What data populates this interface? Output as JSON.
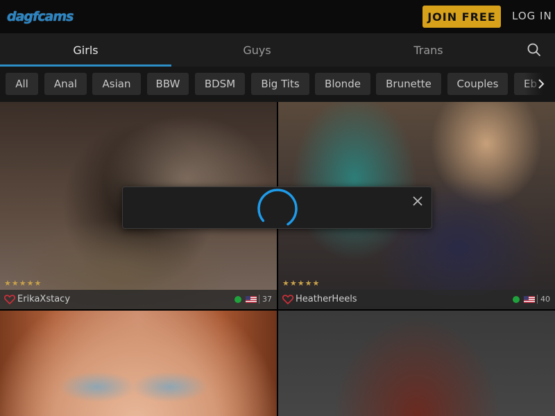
{
  "header": {
    "logo_text": "dagfcams",
    "join_label": "JOIN FREE",
    "login_label": "LOG IN",
    "accent": "#d7a11a",
    "brand": "#2b86c5"
  },
  "tabs": [
    {
      "label": "Girls",
      "active": true
    },
    {
      "label": "Guys",
      "active": false
    },
    {
      "label": "Trans",
      "active": false
    }
  ],
  "search_icon": "search-icon",
  "categories": [
    "All",
    "Anal",
    "Asian",
    "BBW",
    "BDSM",
    "Big Tits",
    "Blonde",
    "Brunette",
    "Couples",
    "Eb"
  ],
  "performers": [
    {
      "name": "ErikaXstacy",
      "viewers": "37",
      "rating_stars": 5,
      "online": true,
      "flag": "US"
    },
    {
      "name": "HeatherHeels",
      "viewers": "40",
      "rating_stars": 5,
      "online": true,
      "flag": "US"
    }
  ],
  "star_char": "★",
  "loader": {
    "state": "loading",
    "close_icon": "close-icon",
    "spinner_color": "#1e9bea"
  },
  "colors": {
    "online": "#1fa33c",
    "heart": "#d0303a",
    "tab_active_underline": "#2d8fc8"
  }
}
